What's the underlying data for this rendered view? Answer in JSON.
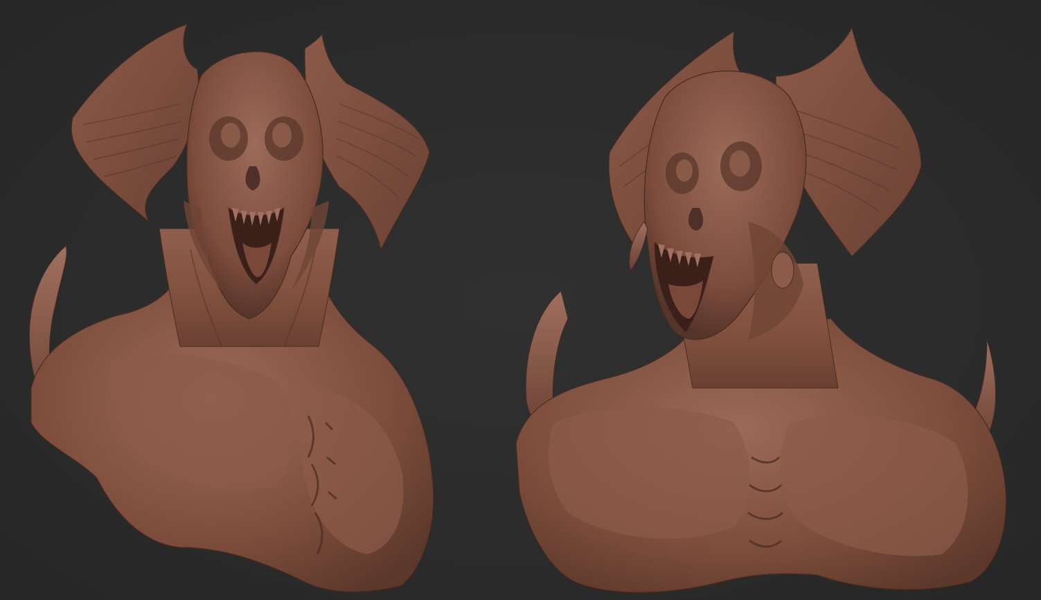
{
  "scene": {
    "background_color": "#2b2b2b",
    "clay_base_color": "#8a5a4a",
    "clay_shadow_color": "#4e3028",
    "clay_highlight_color": "#a8786a",
    "views": [
      {
        "name": "front-view",
        "subject": "creature-bust"
      },
      {
        "name": "three-quarter-view",
        "subject": "creature-bust"
      }
    ]
  }
}
